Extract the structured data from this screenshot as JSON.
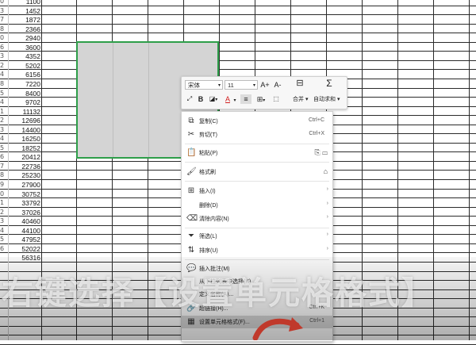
{
  "sheet": {
    "row_headers": [
      "0",
      "3",
      "7",
      "8",
      "0",
      "6",
      "3",
      "2",
      "4",
      "8",
      "5",
      "4",
      "1",
      "2",
      "3",
      "4",
      "5",
      "6",
      "7",
      "8",
      "9",
      "0",
      "1",
      "2",
      "3",
      "4",
      "5",
      "6"
    ],
    "values": [
      "1100",
      "1452",
      "1872",
      "2366",
      "2940",
      "3600",
      "4352",
      "5202",
      "6156",
      "7220",
      "8400",
      "9702",
      "11132",
      "12696",
      "14400",
      "16250",
      "18252",
      "20412",
      "22736",
      "25230",
      "27900",
      "30752",
      "33792",
      "37026",
      "40460",
      "44100",
      "47952",
      "52022",
      "56316"
    ],
    "selection_color": "#2e9e4a"
  },
  "minibar": {
    "font_name": "宋体",
    "font_size": "11",
    "grow_font": "A+",
    "shrink_font": "A-",
    "bold": "B",
    "font_color": "A",
    "merge_label": "合并",
    "autosum_label": "自动求和"
  },
  "menu": {
    "items": [
      {
        "label": "复制(C)",
        "shortcut": "Ctrl+C",
        "icon": "copy-icon",
        "glyph": "⧉"
      },
      {
        "label": "剪切(T)",
        "shortcut": "Ctrl+X",
        "icon": "scissors-icon",
        "glyph": "✂"
      },
      {
        "label": "粘贴(P)",
        "shortcut": "",
        "icon": "paste-icon",
        "glyph": "📋"
      },
      {
        "label": "格式刷",
        "shortcut": "",
        "icon": "format-brush-icon",
        "glyph": "🖌"
      },
      {
        "label": "插入(I)",
        "shortcut": "",
        "icon": "insert-icon",
        "glyph": "⊞"
      },
      {
        "label": "删除(D)",
        "shortcut": "",
        "icon": "",
        "glyph": ""
      },
      {
        "label": "清除内容(N)",
        "shortcut": "",
        "icon": "clear-icon",
        "glyph": "⌫"
      },
      {
        "label": "筛选(L)",
        "shortcut": "",
        "icon": "filter-icon",
        "glyph": "⏷"
      },
      {
        "label": "排序(U)",
        "shortcut": "",
        "icon": "sort-icon",
        "glyph": "⇅"
      },
      {
        "label": "插入批注(M)",
        "shortcut": "",
        "icon": "comment-icon",
        "glyph": "💬"
      },
      {
        "label": "从下拉列表中选择(K)...",
        "shortcut": "",
        "icon": "",
        "glyph": ""
      },
      {
        "label": "定义名称(A)...",
        "shortcut": "",
        "icon": "",
        "glyph": ""
      },
      {
        "label": "超链接(H)...",
        "shortcut": "Ctrl+K",
        "icon": "link-icon",
        "glyph": "🔗"
      },
      {
        "label": "设置单元格格式(F)...",
        "shortcut": "Ctrl+1",
        "icon": "format-cells-icon",
        "glyph": "▦"
      }
    ]
  },
  "caption": {
    "text": "右键选择【设置单元格格式】"
  }
}
